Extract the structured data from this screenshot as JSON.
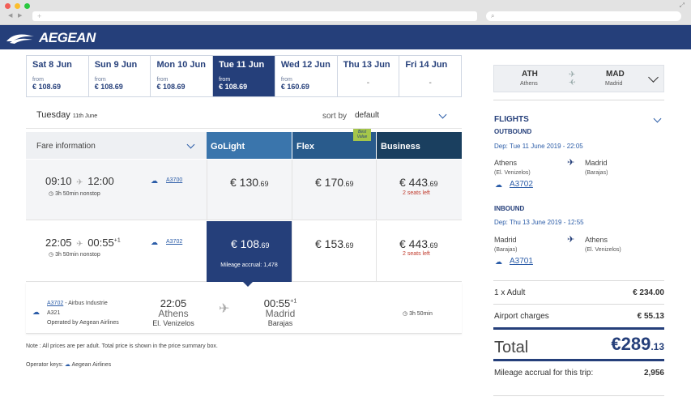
{
  "browser": {
    "new_tab_symbol": "+",
    "search_symbol": "⌕"
  },
  "brand": {
    "name": "AEGEAN",
    "color": "#253f7a"
  },
  "dates": [
    {
      "day": "Sat 8 Jun",
      "from": "from",
      "price": "€ 108.69"
    },
    {
      "day": "Sun 9 Jun",
      "from": "from",
      "price": "€ 108.69"
    },
    {
      "day": "Mon 10 Jun",
      "from": "from",
      "price": "€ 108.69"
    },
    {
      "day": "Tue 11 Jun",
      "from": "from",
      "price": "€ 108.69",
      "active": true
    },
    {
      "day": "Wed 12 Jun",
      "from": "from",
      "price": "€ 160.69"
    },
    {
      "day": "Thu 13 Jun",
      "dash": "-"
    },
    {
      "day": "Fri 14 Jun",
      "dash": "-"
    }
  ],
  "selected_day": {
    "day": "Tuesday",
    "date": "11th June"
  },
  "sort": {
    "label": "sort by",
    "value": "default"
  },
  "fare_header": {
    "label": "Fare information",
    "golight": "GoLight",
    "flex": "Flex",
    "business": "Business",
    "best_value_1": "Best",
    "best_value_2": "Value"
  },
  "flights": [
    {
      "dep": "09:10",
      "arr": "12:00",
      "arr_sup": "",
      "duration": "3h 50min nonstop",
      "code": "A3700",
      "golight": {
        "main": "€ 130",
        "dec": ".69"
      },
      "flex": {
        "main": "€ 170",
        "dec": ".69"
      },
      "business": {
        "main": "€ 443",
        "dec": ".69"
      },
      "seats": "2 seats left"
    },
    {
      "dep": "22:05",
      "arr": "00:55",
      "arr_sup": "+1",
      "duration": "3h 50min nonstop",
      "code": "A3702",
      "golight": {
        "main": "€ 108",
        "dec": ".69"
      },
      "flex": {
        "main": "€ 153",
        "dec": ".69"
      },
      "business": {
        "main": "€ 443",
        "dec": ".69"
      },
      "seats": "2 seats left",
      "mileage": "Mileage accrual: 1,478"
    }
  ],
  "detail": {
    "code": "A3702",
    "aircraft_maker": " - Airbus Industrie",
    "aircraft": "A321",
    "operated": "Operated by Aegean Airlines",
    "dep_time": "22:05",
    "dep_city": "Athens",
    "dep_airport": "El. Venizelos",
    "arr_time": "00:55",
    "arr_sup": "+1",
    "arr_city": "Madrid",
    "arr_airport": "Barajas",
    "duration": "3h 50min"
  },
  "note": "Note : All prices are per adult. Total price is shown in the price summary box.",
  "operator_keys": {
    "label": "Operator keys:",
    "airline": "Aegean Airlines"
  },
  "summary": {
    "route": {
      "from_code": "ATH",
      "from_city": "Athens",
      "to_code": "MAD",
      "to_city": "Madrid"
    },
    "flights_title": "FLIGHTS",
    "outbound": {
      "title": "OUTBOUND",
      "dep": "Dep: Tue 11 June 2019 - 22:05",
      "from_city": "Athens",
      "from_airport": "(El. Venizelos)",
      "to_city": "Madrid",
      "to_airport": "(Barajas)",
      "code": "A3702"
    },
    "inbound": {
      "title": "INBOUND",
      "dep": "Dep: Thu 13 June 2019 - 12:55",
      "from_city": "Madrid",
      "from_airport": "(Barajas)",
      "to_city": "Athens",
      "to_airport": "(El. Venizelos)",
      "code": "A3701"
    },
    "adult_label": "1 x Adult",
    "adult_value": "€ 234.00",
    "charges_label": "Airport charges",
    "charges_value": "€ 55.13",
    "total_label": "Total",
    "total_main": "€289",
    "total_dec": ".13",
    "mileage_label": "Mileage accrual for this trip:",
    "mileage_value": "2,956"
  }
}
